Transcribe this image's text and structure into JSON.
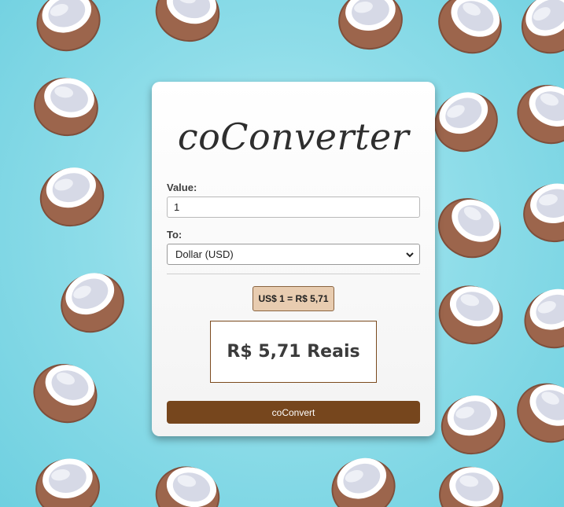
{
  "app": {
    "title": "coConverter"
  },
  "form": {
    "value_label": "Value:",
    "value_input": "1",
    "to_label": "To:",
    "currency_selected": "Dollar (USD)",
    "rate_text": "US$ 1 = R$ 5,71",
    "result_text": "R$ 5,71 Reais",
    "convert_button": "coConvert"
  },
  "background": {
    "pattern_icon": "coconut-icon",
    "color": "#8fdde9"
  },
  "colors": {
    "accent": "#76461d",
    "rate_badge": "#e8ccb0"
  }
}
